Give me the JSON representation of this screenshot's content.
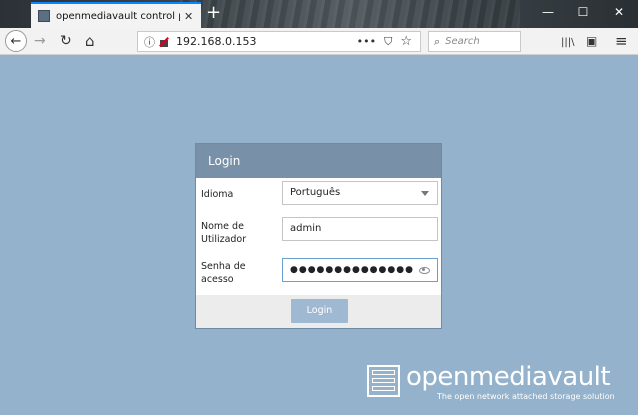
{
  "browser": {
    "tab_title": "openmediavault control panel",
    "tab_close": "✕",
    "new_tab": "+",
    "window": {
      "minimize": "—",
      "maximize": "☐",
      "close": "✕"
    },
    "nav": {
      "back": "←",
      "forward": "→",
      "reload": "↻",
      "home": "⌂"
    },
    "url": "192.168.0.153",
    "url_actions": {
      "more": "•••",
      "pocket": "⛉",
      "bookmark": "☆"
    },
    "search_placeholder": "Search",
    "toolbar": {
      "library": "|||\\",
      "sidebar": "▣",
      "menu": "≡"
    }
  },
  "login": {
    "title": "Login",
    "fields": {
      "language": {
        "label": "Idioma",
        "value": "Português"
      },
      "username": {
        "label_line1": "Nome de",
        "label_line2": "Utilizador",
        "value": "admin"
      },
      "password": {
        "label_line1": "Senha de",
        "label_line2": "acesso",
        "value": "●●●●●●●●●●●●●●"
      }
    },
    "button_label": "Login"
  },
  "brand": {
    "name": "openmediavault",
    "tagline": "The open network attached storage solution"
  },
  "colors": {
    "page_background": "#94b2cb",
    "panel_header": "#7891a8",
    "button": "#9fb9d2",
    "tab_accent": "#0a84ff"
  }
}
